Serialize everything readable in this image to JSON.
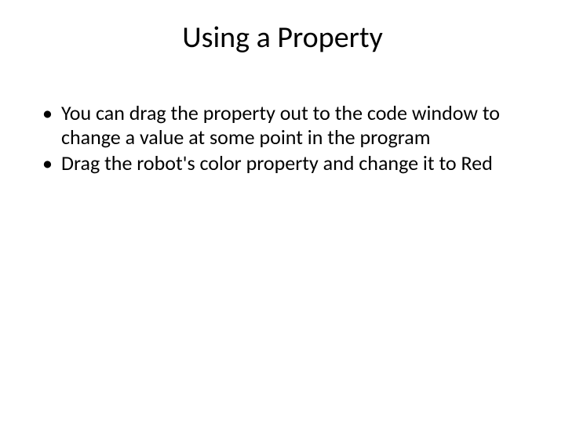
{
  "slide": {
    "title": "Using a Property",
    "bullets": [
      "You can drag the property out to the code window to change a value at some point in the program",
      "Drag the robot's color property and change it to Red"
    ]
  }
}
